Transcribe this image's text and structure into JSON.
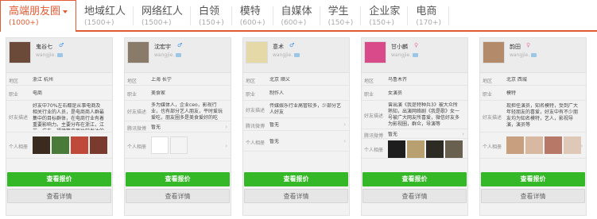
{
  "tabs": [
    {
      "name": "高端朋友圈",
      "count": "(1000+)",
      "active": true
    },
    {
      "name": "地域红人",
      "count": "(1500+)"
    },
    {
      "name": "网络红人",
      "count": "(1500+)"
    },
    {
      "name": "白领",
      "count": "(150+)"
    },
    {
      "name": "模特",
      "count": "(600+)"
    },
    {
      "name": "自媒体",
      "count": "(600+)"
    },
    {
      "name": "学生",
      "count": "(150+)"
    },
    {
      "name": "企业家",
      "count": "(150+)"
    },
    {
      "name": "电商",
      "count": "(170+)"
    }
  ],
  "labels": {
    "region": "地区",
    "job": "职业",
    "desc": "好友描述",
    "weibo": "腾讯微博",
    "album": "个人相册",
    "quote": "查看报价",
    "detail": "查看详情"
  },
  "cards": [
    {
      "name": "鬼谷七",
      "handle": "wangjie.",
      "badge": "♂",
      "badge_color": "#3a8ee6",
      "region": "浙江 杭州",
      "job": "电商",
      "desc": "好友中70%左右都是从事电商及相关行业的人员，是电商商人群最集中的目标群体，在电商行业有着重要影响力。主要分布在浙江，江苏，广东，福建等电商比较发达的省份。",
      "weibo": "",
      "avatar_color": "#6b4a3a"
    },
    {
      "name": "沈宏宇",
      "handle": "wangjie.",
      "badge": "♂",
      "badge_color": "#3a8ee6",
      "region": "上海 长宁",
      "job": "美食家",
      "desc": "多为媒体人，企业ceo，影视行业，也有部分艺人朋友，平时爱玩爱吃，朋友圈多是美食爱好的吃货。",
      "weibo": "暂无",
      "avatar_color": "#8a7a6a"
    },
    {
      "name": "意术",
      "handle": "wangjie.",
      "badge": "♂",
      "badge_color": "#3a8ee6",
      "region": "北京 顺义",
      "job": "制作人",
      "desc": "传媒娱乐行业高管较多，少部分艺人好友",
      "weibo": "暂无",
      "avatar_color": "#e6d9a8"
    },
    {
      "name": "甘小麟",
      "handle": "wangjie.",
      "badge": "♀",
      "badge_color": "#e87ab0",
      "region": "乌鲁木齐",
      "job": "女演员",
      "desc": "曾出演《我是特种兵3》被大众所熟知，出演网络剧《我是歌》女一号被广大网友所喜爱，微信好友多为影视圈，群众，导演等",
      "weibo": "暂无",
      "avatar_color": "#d94a8a"
    },
    {
      "name": "韵田",
      "handle": "wangjie.",
      "badge": "♀",
      "badge_color": "#e87ab0",
      "region": "北京 西城",
      "job": "模特",
      "desc": "现担任演员，知名模特，受到广大年轻朋友的喜爱，好友中有不少朋友均为知名模特，艺人，影视导演，演员等",
      "weibo": "",
      "avatar_color": "#b38a6a"
    }
  ]
}
